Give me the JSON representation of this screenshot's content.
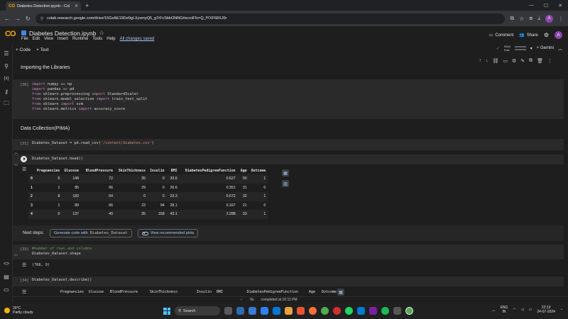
{
  "browser": {
    "tab_title": "Diabetes Detection.ipynb - Col",
    "tab_logo": "CO",
    "url": "colab.research.google.com/drive/15GxAE19De9gLXyomyQ5_g7rFcSbbONNG#scrollTo=Q_fYXF68XJ0r",
    "profile_initial": "A"
  },
  "colab": {
    "logo": "CO",
    "notebook_title": "Diabetes Detection.ipynb",
    "menu": [
      "File",
      "Edit",
      "View",
      "Insert",
      "Runtime",
      "Tools",
      "Help"
    ],
    "saved_status": "All changes saved",
    "comment_label": "Comment",
    "share_label": "Share",
    "profile_initial": "A"
  },
  "toolbar": {
    "code_label": "+ Code",
    "text_label": "+ Text",
    "ram_label": "RAM",
    "disk_label": "Disk",
    "gemini_label": "+ Gemini"
  },
  "cells": {
    "import_heading": "Importing the Libraries",
    "import_prompt": "[30]",
    "import_code": [
      {
        "kw": "import",
        "rest": " numpy ",
        "kw2": "as",
        "rest2": " np"
      },
      {
        "kw": "import",
        "rest": " pandas ",
        "kw2": "as",
        "rest2": " pd"
      },
      {
        "kw": "from",
        "rest": " sklearn.preprocessing ",
        "kw2": "import",
        "rest2": " StandardScaler"
      },
      {
        "kw": "from",
        "rest": " sklearn.model_selection ",
        "kw2": "import",
        "rest2": " train_test_split"
      },
      {
        "kw": "from",
        "rest": " sklearn ",
        "kw2": "import",
        "rest2": " svm"
      },
      {
        "kw": "from",
        "rest": " sklearn.metrics ",
        "kw2": "import",
        "rest2": " accuracy_score"
      }
    ],
    "data_heading": "Data Collection(PIMA)",
    "read_prompt": "[31]",
    "read_code_pre": "Diabetes_Dataset = pd.read_csv(",
    "read_code_str": "'/content/diabetes.csv'",
    "read_code_post": ")",
    "exec_mark_1": "0s",
    "head_code": "Diabetes_Dataset.head()",
    "exec_mark_2": "0s",
    "table": {
      "columns": [
        "Pregnancies",
        "Glucose",
        "BloodPressure",
        "SkinThickness",
        "Insulin",
        "BMI",
        "DiabetesPedigreeFunction",
        "Age",
        "Outcome"
      ],
      "rows": [
        {
          "index": "0",
          "values": [
            "6",
            "148",
            "72",
            "35",
            "0",
            "33.6",
            "0.627",
            "50",
            "1"
          ]
        },
        {
          "index": "1",
          "values": [
            "1",
            "85",
            "66",
            "29",
            "0",
            "26.6",
            "0.351",
            "31",
            "0"
          ]
        },
        {
          "index": "2",
          "values": [
            "8",
            "183",
            "64",
            "0",
            "0",
            "23.3",
            "0.672",
            "32",
            "1"
          ]
        },
        {
          "index": "3",
          "values": [
            "1",
            "89",
            "66",
            "23",
            "94",
            "28.1",
            "0.167",
            "21",
            "0"
          ]
        },
        {
          "index": "4",
          "values": [
            "0",
            "137",
            "40",
            "35",
            "168",
            "43.1",
            "2.288",
            "33",
            "1"
          ]
        }
      ]
    },
    "next_steps_label": "Next steps:",
    "next_step_1_pre": "Generate code with ",
    "next_step_1_var": "Diabetes_Dataset",
    "next_step_2": "View recommended plots",
    "shape_prompt": "[33]",
    "exec_mark_3": "0s",
    "shape_comment": "#number of rows and columns",
    "shape_code": "Diabetes_Dataset.shape",
    "shape_output": "(768, 9)",
    "describe_prompt": "[34]",
    "describe_code": "Diabetes_Dataset.describe()",
    "describe_columns": [
      "Pregnancies",
      "Glucose",
      "BloodPressure",
      "SkinThickness",
      "Insulin",
      "BMI",
      "DiabetesPedigreeFunction",
      "Age",
      "Outcome"
    ]
  },
  "statusbar": {
    "check": "✓",
    "duration": "0s",
    "completed": "completed at 10:11 PM"
  },
  "taskbar": {
    "temperature": "29°C",
    "weather": "Partly cloudy",
    "search_label": "Search",
    "lang_top": "ENG",
    "lang_bottom": "IN",
    "time": "22:13",
    "date": "24-07-2024"
  },
  "colors": {
    "colab_orange": "#f9ab00",
    "link_blue": "#a8c7fa",
    "keyword": "#c586c0",
    "string": "#ce9178",
    "success_green": "#34a853"
  }
}
